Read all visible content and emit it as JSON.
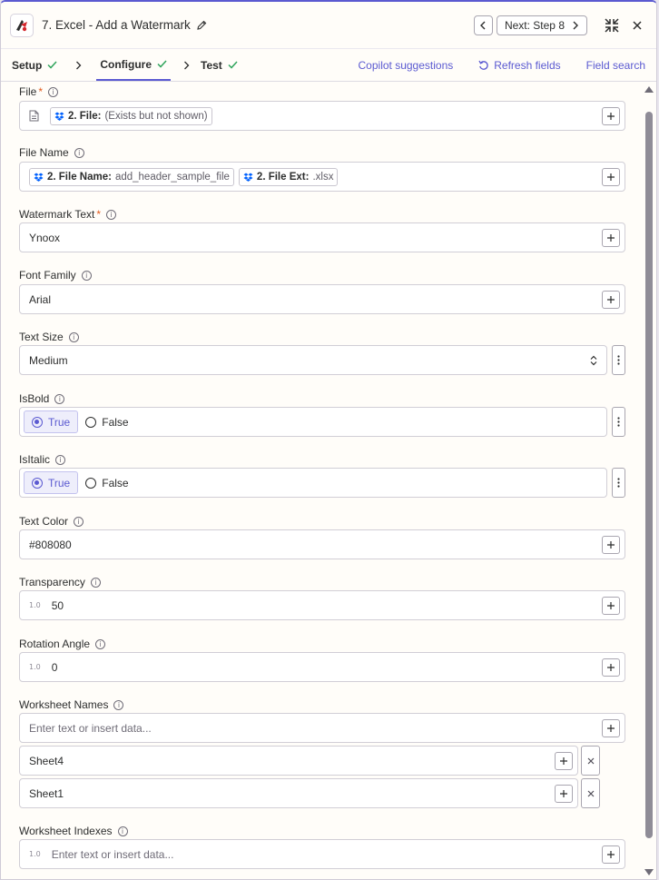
{
  "header": {
    "title": "7. Excel - Add a Watermark",
    "next_label": "Next: Step 8"
  },
  "tabs": [
    {
      "label": "Setup"
    },
    {
      "label": "Configure"
    },
    {
      "label": "Test"
    }
  ],
  "tab_actions": {
    "copilot": "Copilot suggestions",
    "refresh": "Refresh fields",
    "field_search": "Field search"
  },
  "colors": {
    "accent": "#5b5ad1",
    "check": "#2fa45b",
    "required": "#e25a1c"
  },
  "fields": {
    "file": {
      "label": "File",
      "required_mark": "*",
      "pill_label": "2. File:",
      "pill_value": "(Exists but not shown)"
    },
    "file_name": {
      "label": "File Name",
      "pill1_label": "2. File Name:",
      "pill1_value": "add_header_sample_file",
      "pill2_label": "2. File Ext:",
      "pill2_value": ".xlsx"
    },
    "watermark_text": {
      "label": "Watermark Text",
      "required_mark": "*",
      "value": "Ynoox"
    },
    "font_family": {
      "label": "Font Family",
      "value": "Arial"
    },
    "text_size": {
      "label": "Text Size",
      "value": "Medium"
    },
    "is_bold": {
      "label": "IsBold",
      "option_true": "True",
      "option_false": "False",
      "selected": "True"
    },
    "is_italic": {
      "label": "IsItalic",
      "option_true": "True",
      "option_false": "False",
      "selected": "True"
    },
    "text_color": {
      "label": "Text Color",
      "value": "#808080"
    },
    "transparency": {
      "label": "Transparency",
      "badge": "1.0",
      "value": "50"
    },
    "rotation_angle": {
      "label": "Rotation Angle",
      "badge": "1.0",
      "value": "0"
    },
    "worksheet_names": {
      "label": "Worksheet Names",
      "placeholder": "Enter text or insert data...",
      "items": [
        "Sheet4",
        "Sheet1"
      ]
    },
    "worksheet_indexes": {
      "label": "Worksheet Indexes",
      "badge": "1.0",
      "placeholder": "Enter text or insert data..."
    }
  }
}
